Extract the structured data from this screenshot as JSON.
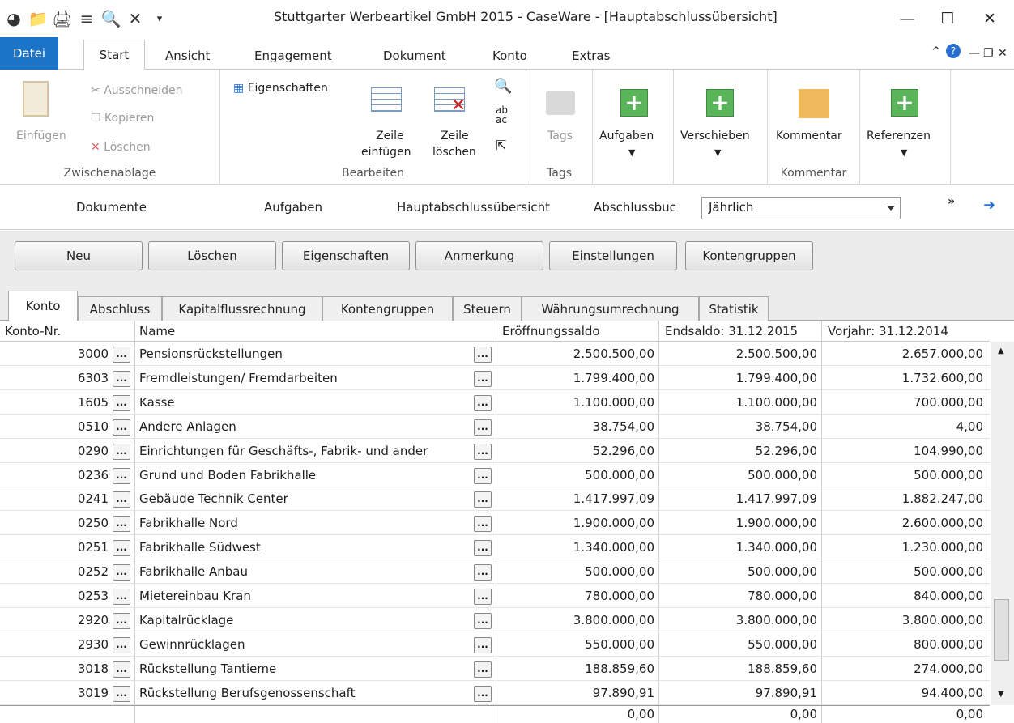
{
  "window": {
    "title": "Stuttgarter Werbeartikel GmbH 2015 - CaseWare - [Hauptabschlussübersicht]"
  },
  "menu": {
    "file": "Datei",
    "tabs": [
      "Start",
      "Ansicht",
      "Engagement",
      "Dokument",
      "Konto",
      "Extras"
    ]
  },
  "ribbon": {
    "paste": "Einfügen",
    "cut": "Ausschneiden",
    "copy": "Kopieren",
    "delete": "Löschen",
    "clipboard_group": "Zwischenablage",
    "properties": "Eigenschaften",
    "insert_row_1": "Zeile",
    "insert_row_2": "einfügen",
    "delete_row_1": "Zeile",
    "delete_row_2": "löschen",
    "edit_group": "Bearbeiten",
    "tags": "Tags",
    "tags_group": "Tags",
    "tasks": "Aufgaben",
    "move": "Verschieben",
    "comment": "Kommentar",
    "comment_group": "Kommentar",
    "references": "Referenzen"
  },
  "nav": {
    "documents": "Dokumente",
    "tasks": "Aufgaben",
    "overview": "Hauptabschlussübersicht",
    "journal": "Abschlussbuc",
    "period": "Jährlich"
  },
  "buttons": [
    "Neu",
    "Löschen",
    "Eigenschaften",
    "Anmerkung",
    "Einstellungen",
    "Kontengruppen"
  ],
  "tabs": [
    "Konto",
    "Abschluss",
    "Kapitalflussrechnung",
    "Kontengruppen",
    "Steuern",
    "Währungsumrechnung",
    "Statistik"
  ],
  "table": {
    "headers": [
      "Konto-Nr.",
      "Name",
      "Eröffnungssaldo",
      "Endsaldo: 31.12.2015",
      "Vorjahr: 31.12.2014"
    ],
    "rows": [
      {
        "nr": "3000",
        "name": "Pensionsrückstellungen",
        "open": "2.500.500,00",
        "end": "2.500.500,00",
        "prev": "2.657.000,00"
      },
      {
        "nr": "6303",
        "name": "Fremdleistungen/ Fremdarbeiten",
        "open": "1.799.400,00",
        "end": "1.799.400,00",
        "prev": "1.732.600,00"
      },
      {
        "nr": "1605",
        "name": "Kasse",
        "open": "1.100.000,00",
        "end": "1.100.000,00",
        "prev": "700.000,00"
      },
      {
        "nr": "0510",
        "name": "Andere Anlagen",
        "open": "38.754,00",
        "end": "38.754,00",
        "prev": "4,00"
      },
      {
        "nr": "0290",
        "name": "Einrichtungen für Geschäfts-, Fabrik- und ander",
        "open": "52.296,00",
        "end": "52.296,00",
        "prev": "104.990,00"
      },
      {
        "nr": "0236",
        "name": "Grund und Boden Fabrikhalle",
        "open": "500.000,00",
        "end": "500.000,00",
        "prev": "500.000,00"
      },
      {
        "nr": "0241",
        "name": "Gebäude Technik Center",
        "open": "1.417.997,09",
        "end": "1.417.997,09",
        "prev": "1.882.247,00"
      },
      {
        "nr": "0250",
        "name": "Fabrikhalle Nord",
        "open": "1.900.000,00",
        "end": "1.900.000,00",
        "prev": "2.600.000,00"
      },
      {
        "nr": "0251",
        "name": "Fabrikhalle Südwest",
        "open": "1.340.000,00",
        "end": "1.340.000,00",
        "prev": "1.230.000,00"
      },
      {
        "nr": "0252",
        "name": "Fabrikhalle Anbau",
        "open": "500.000,00",
        "end": "500.000,00",
        "prev": "500.000,00"
      },
      {
        "nr": "0253",
        "name": "Mietereinbau Kran",
        "open": "780.000,00",
        "end": "780.000,00",
        "prev": "840.000,00"
      },
      {
        "nr": "2920",
        "name": "Kapitalrücklage",
        "open": "3.800.000,00",
        "end": "3.800.000,00",
        "prev": "3.800.000,00"
      },
      {
        "nr": "2930",
        "name": "Gewinnrücklagen",
        "open": "550.000,00",
        "end": "550.000,00",
        "prev": "800.000,00"
      },
      {
        "nr": "3018",
        "name": "Rückstellung Tantieme",
        "open": "188.859,60",
        "end": "188.859,60",
        "prev": "274.000,00"
      },
      {
        "nr": "3019",
        "name": "Rückstellung Berufsgenossenschaft",
        "open": "97.890,91",
        "end": "97.890,91",
        "prev": "94.400,00"
      }
    ],
    "totals": {
      "open": "0,00",
      "end": "0,00",
      "prev": "0,00"
    }
  },
  "colors": {
    "accent": "#1c74c9",
    "add_green": "#5ab45a",
    "comment_orange": "#f0b95c"
  }
}
